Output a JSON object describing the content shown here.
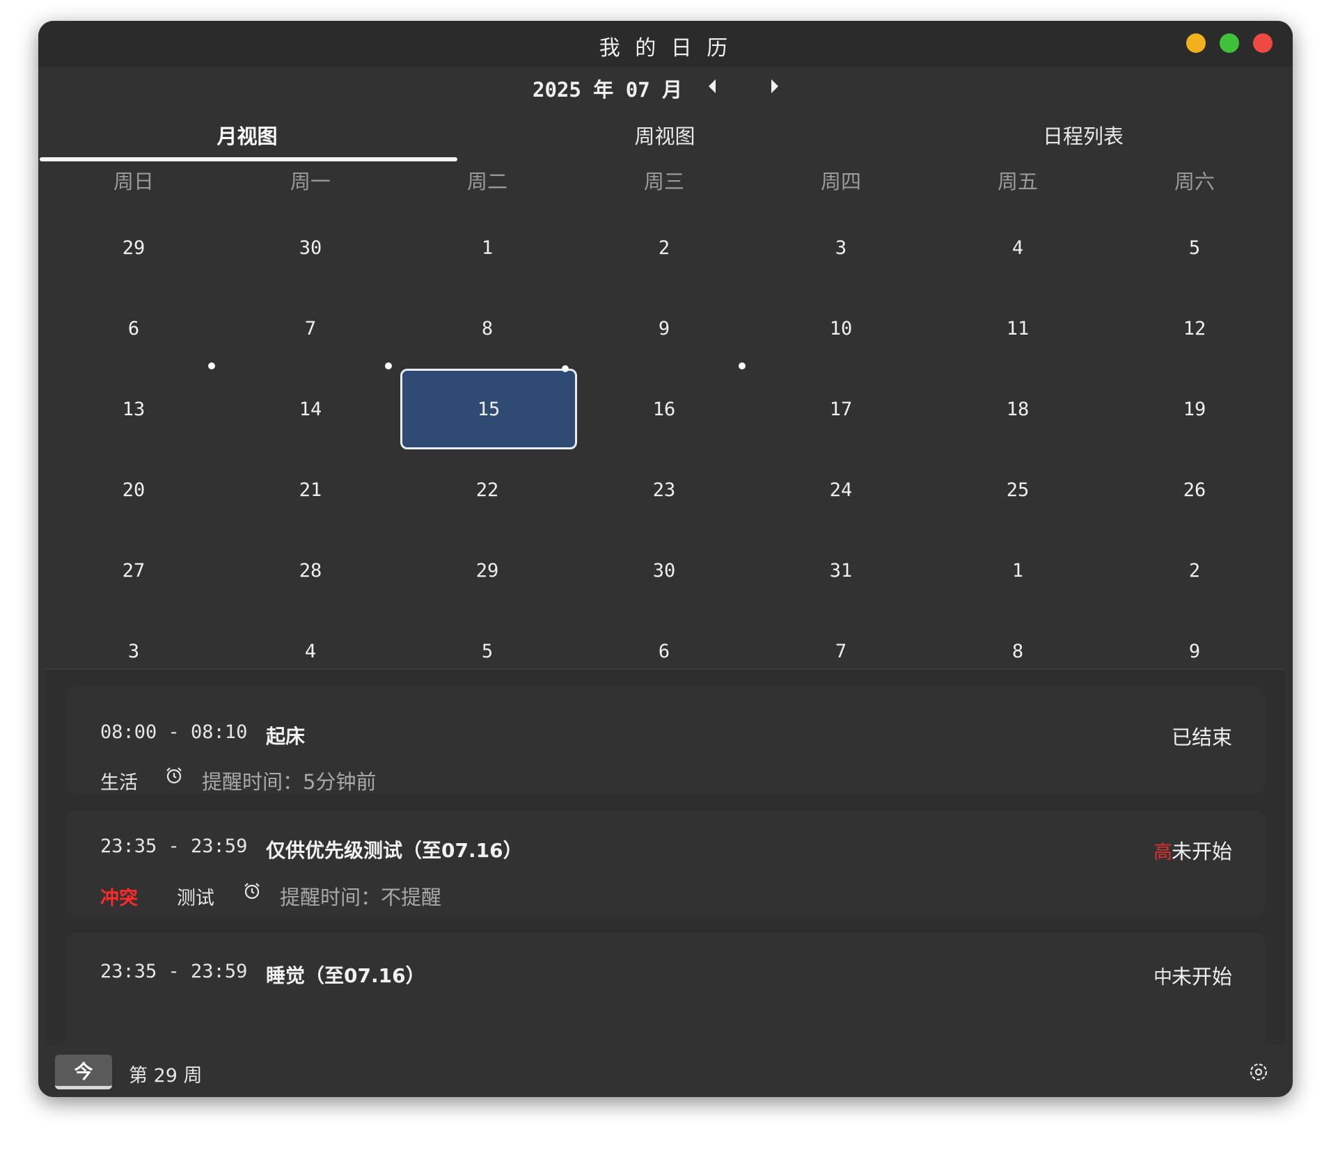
{
  "window": {
    "title": "我 的 日 历"
  },
  "month_bar": {
    "label": "2025 年 07 月"
  },
  "tabs": [
    "月视图",
    "周视图",
    "日程列表"
  ],
  "weekdays": [
    "周日",
    "周一",
    "周二",
    "周三",
    "周四",
    "周五",
    "周六"
  ],
  "calendar": {
    "selected_day": "15",
    "rows": [
      [
        "29",
        "30",
        "1",
        "2",
        "3",
        "4",
        "5"
      ],
      [
        "6",
        "7",
        "8",
        "9",
        "10",
        "11",
        "12"
      ],
      [
        "13",
        "14",
        "15",
        "16",
        "17",
        "18",
        "19"
      ],
      [
        "20",
        "21",
        "22",
        "23",
        "24",
        "25",
        "26"
      ],
      [
        "27",
        "28",
        "29",
        "30",
        "31",
        "1",
        "2"
      ],
      [
        "3",
        "4",
        "5",
        "6",
        "7",
        "8",
        "9"
      ]
    ]
  },
  "events": [
    {
      "time": "08:00 - 08:10",
      "title": "起床",
      "priority": "",
      "status": "已结束",
      "conflict": "",
      "category": "生活",
      "reminder": "提醒时间：5分钟前"
    },
    {
      "time": "23:35 - 23:59",
      "title": "仅供优先级测试（至07.16）",
      "priority": "高",
      "priority_color": "#e03030",
      "status": "未开始",
      "conflict": "冲突",
      "category": "测试",
      "reminder": "提醒时间：不提醒"
    },
    {
      "time": "23:35 - 23:59",
      "title": "睡觉（至07.16）",
      "priority": "中",
      "priority_color": "#e6e6e6",
      "status": "未开始",
      "conflict": "",
      "category": "",
      "reminder": ""
    }
  ],
  "footer": {
    "today_label": "今",
    "week_label": "第 29 周"
  },
  "colors": {
    "selected_day_bg": "#2f4a73",
    "window_bg": "#323232",
    "conflict": "#ff2a2a"
  }
}
